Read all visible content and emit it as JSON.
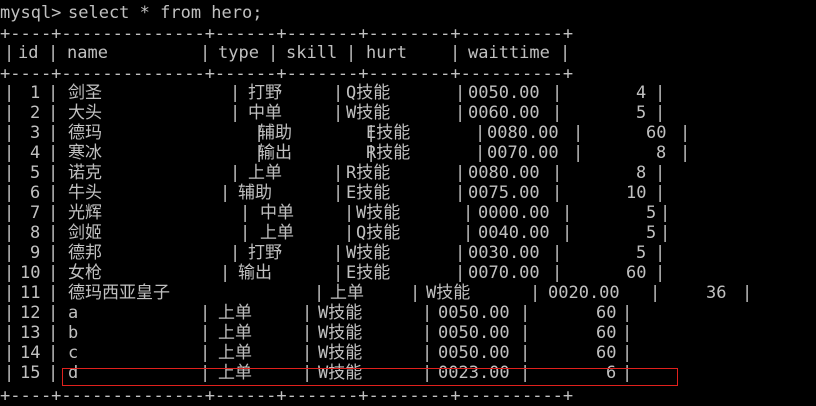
{
  "prompt": "mysql>",
  "command": "select * from hero;",
  "border_line": "+----+--------------+------+-------+--------+----------+",
  "columns": [
    "id",
    "name",
    "type",
    "skill",
    "hurt",
    "waittime"
  ],
  "rows": [
    {
      "id": "1",
      "name": "剑圣",
      "type": "打野",
      "skill": "Q技能",
      "hurt": "0050.00",
      "waittime": "4"
    },
    {
      "id": "2",
      "name": "大头",
      "type": "中单",
      "skill": "W技能",
      "hurt": "0060.00",
      "waittime": "5"
    },
    {
      "id": "3",
      "name": "德玛",
      "type": "辅助",
      "skill": "E技能",
      "hurt": "0080.00",
      "waittime": "60"
    },
    {
      "id": "4",
      "name": "寒冰",
      "type": "输出",
      "skill": "R技能",
      "hurt": "0070.00",
      "waittime": "8"
    },
    {
      "id": "5",
      "name": "诺克",
      "type": "上单",
      "skill": "R技能",
      "hurt": "0080.00",
      "waittime": "8"
    },
    {
      "id": "6",
      "name": "牛头",
      "type": "辅助",
      "skill": "E技能",
      "hurt": "0075.00",
      "waittime": "10"
    },
    {
      "id": "7",
      "name": "光辉",
      "type": "中单",
      "skill": "W技能",
      "hurt": "0000.00",
      "waittime": "5"
    },
    {
      "id": "8",
      "name": "剑姬",
      "type": "上单",
      "skill": "Q技能",
      "hurt": "0040.00",
      "waittime": "5"
    },
    {
      "id": "9",
      "name": "德邦",
      "type": "打野",
      "skill": "W技能",
      "hurt": "0030.00",
      "waittime": "5"
    },
    {
      "id": "10",
      "name": "女枪",
      "type": "输出",
      "skill": "E技能",
      "hurt": "0070.00",
      "waittime": "60"
    },
    {
      "id": "11",
      "name": "德玛西亚皇子",
      "type": "上单",
      "skill": "W技能",
      "hurt": "0020.00",
      "waittime": "36"
    },
    {
      "id": "12",
      "name": "a",
      "type": "上单",
      "skill": "W技能",
      "hurt": "0050.00",
      "waittime": "60"
    },
    {
      "id": "13",
      "name": "b",
      "type": "上单",
      "skill": "W技能",
      "hurt": "0050.00",
      "waittime": "60"
    },
    {
      "id": "14",
      "name": "c",
      "type": "上单",
      "skill": "W技能",
      "hurt": "0050.00",
      "waittime": "60"
    },
    {
      "id": "15",
      "name": "d",
      "type": "上单",
      "skill": "W技能",
      "hurt": "0023.00",
      "waittime": "6"
    }
  ],
  "highlight_color": "#e0211d"
}
